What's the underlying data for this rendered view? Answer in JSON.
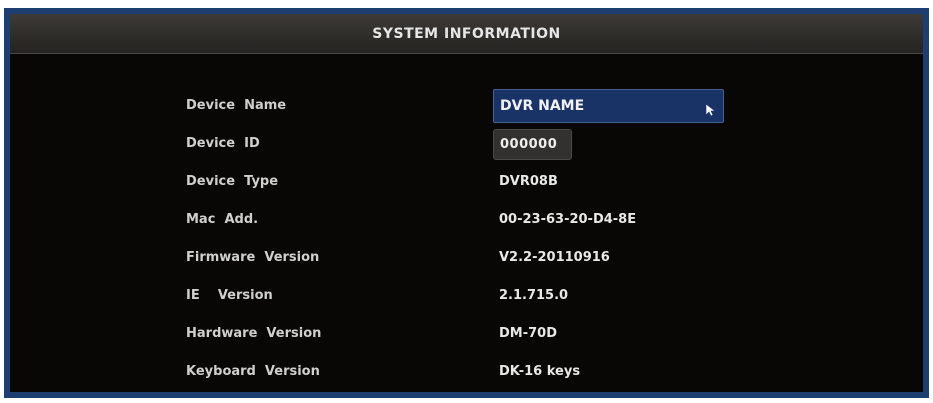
{
  "window": {
    "title": "SYSTEM INFORMATION"
  },
  "colors": {
    "frame": "#1d3e70",
    "background": "#080706",
    "input_highlight": "#1a3367",
    "text": "#e8e8e8"
  },
  "fields": {
    "device_name": {
      "label": "Device  Name",
      "value": "DVR NAME"
    },
    "device_id": {
      "label": "Device  ID",
      "value": "000000"
    },
    "device_type": {
      "label": "Device  Type",
      "value": "DVR08B"
    },
    "mac": {
      "label": "Mac  Add.",
      "value": "00-23-63-20-D4-8E"
    },
    "firmware": {
      "label": "Firmware  Version",
      "value": "V2.2-20110916"
    },
    "ie": {
      "label": "IE    Version",
      "value": "2.1.715.0"
    },
    "hardware": {
      "label": "Hardware  Version",
      "value": "DM-70D"
    },
    "keyboard": {
      "label": "Keyboard  Version",
      "value": "DK-16 keys"
    }
  },
  "icons": {
    "pointer": "mouse-pointer-icon"
  }
}
